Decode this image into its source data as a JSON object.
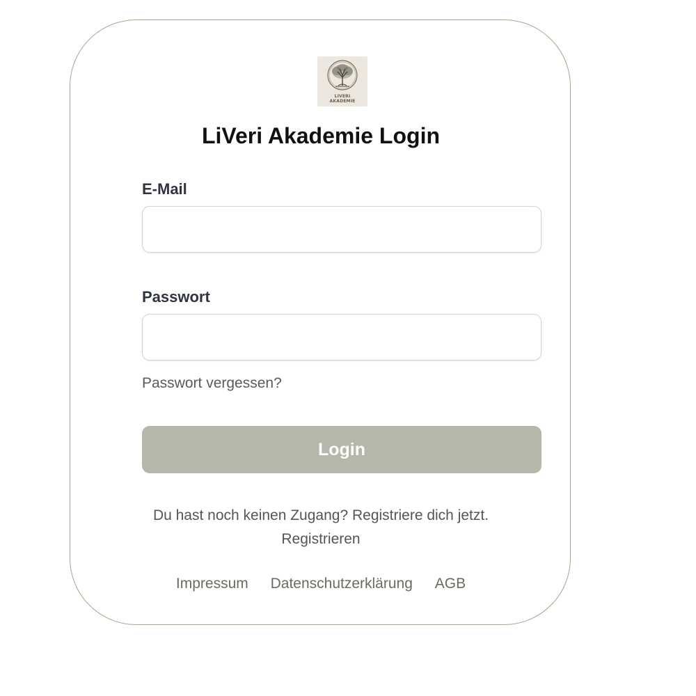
{
  "logo": {
    "icon": "tree-icon",
    "line1": "LIVERI",
    "line2": "AKADEMIE"
  },
  "title": "LiVeri Akademie Login",
  "form": {
    "email_label": "E-Mail",
    "email_value": "",
    "password_label": "Passwort",
    "password_value": "",
    "forgot_label": "Passwort vergessen?",
    "login_label": "Login"
  },
  "register": {
    "prompt": "Du hast noch keinen Zugang? Registriere dich jetzt.",
    "link_label": "Registrieren"
  },
  "footer": {
    "links": [
      "Impressum",
      "Datenschutzerklärung",
      "AGB"
    ]
  },
  "colors": {
    "card_border": "#b29e86",
    "button_bg": "#b6b6aa",
    "logo_bg": "#ece8df"
  }
}
